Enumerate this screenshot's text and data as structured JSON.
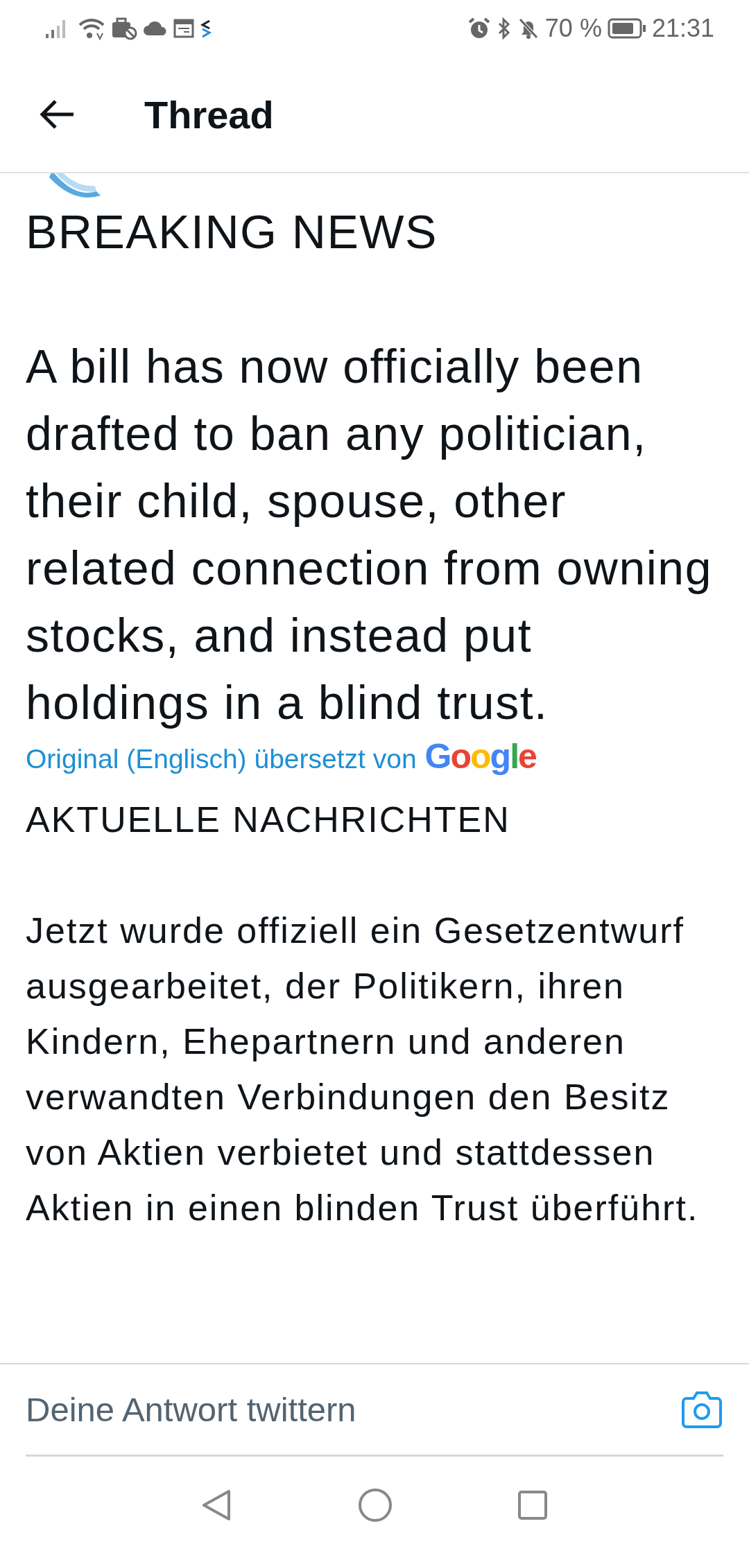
{
  "status_bar": {
    "battery": "70 %",
    "time": "21:31"
  },
  "header": {
    "title": "Thread"
  },
  "tweet": {
    "paragraphs": [
      "BREAKING NEWS",
      "A bill has now officially been drafted to ban any politician, their child, spouse, other related connection from owning stocks, and instead put holdings in a blind trust."
    ],
    "translation_credit": "Original (Englisch) übersetzt von",
    "translation_provider": "Google",
    "translated_paragraphs": [
      "AKTUELLE NACHRICHTEN",
      "Jetzt wurde offiziell ein Gesetzentwurf ausgearbeitet, der Politikern, ihren Kindern, Ehepartnern und anderen verwandten Verbindungen den Besitz von Aktien verbietet und stattdessen Aktien in einen blinden Trust überführt."
    ]
  },
  "reply": {
    "placeholder": "Deine Antwort twittern"
  }
}
